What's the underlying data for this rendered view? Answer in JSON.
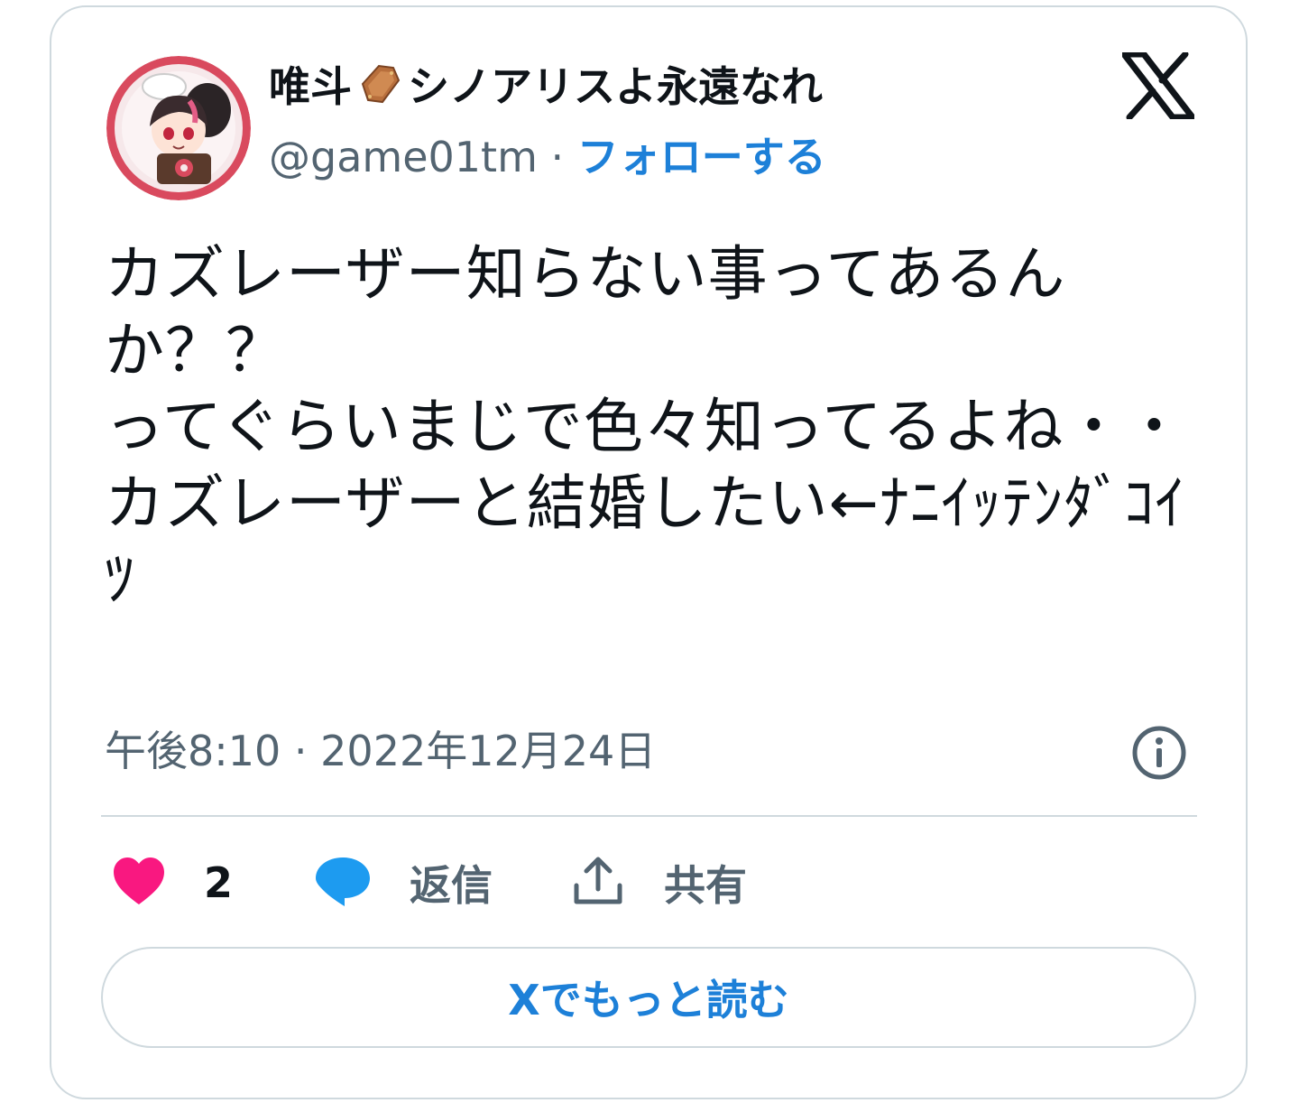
{
  "tweet": {
    "display_name_part1": "唯斗",
    "display_name_icon": "coffin-emoji",
    "display_name_part2": "シノアリスよ永遠なれ",
    "handle": "@game01tm",
    "separator": " · ",
    "follow_label": "フォローする",
    "text": "カズレーザー知らない事ってあるんか？？\nってぐらいまじで色々知ってるよね・・\nカズレーザーと結婚したい←ﾅﾆｲｯﾃﾝﾀﾞｺｲﾂ",
    "timestamp": "午後8:10 · 2022年12月24日",
    "like_count": "2",
    "reply_label": "返信",
    "share_label": "共有",
    "read_more_label": "Xでもっと読む"
  },
  "icons": {
    "logo": "x-logo-icon",
    "info": "info-icon",
    "like": "heart-icon",
    "reply": "speech-bubble-icon",
    "share": "upload-share-icon"
  },
  "colors": {
    "accent_blue": "#1d80d8",
    "like_pink": "#f91880",
    "reply_blue": "#1d9bf0",
    "muted_text": "#536471",
    "border": "#cfd9de"
  }
}
